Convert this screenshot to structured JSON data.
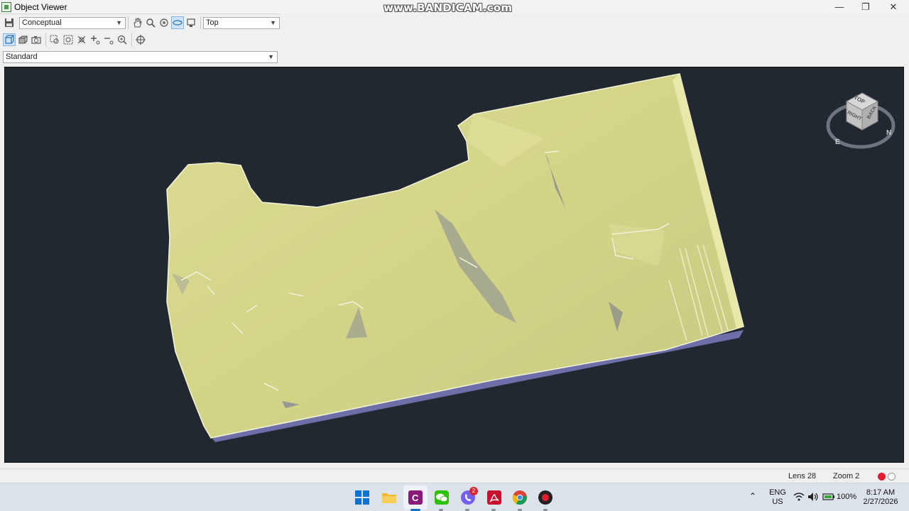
{
  "window": {
    "title": "Object Viewer",
    "watermark": "www.BANDICAM.com",
    "controls": {
      "minimize": "—",
      "restore": "❐",
      "close": "✕"
    }
  },
  "toolbar": {
    "visual_style": {
      "selected": "Conceptual"
    },
    "view": {
      "selected": "Top"
    },
    "projection": {
      "selected": "Standard"
    },
    "nav_icons": [
      "pan-icon",
      "zoom-icon",
      "orbit-icon",
      "orbit-3d-icon",
      "view-icon"
    ],
    "view_icons": [
      "parallel-icon",
      "perspective-icon",
      "camera-icon",
      "zoom-window-icon",
      "zoom-extents-icon",
      "zoom-object-icon",
      "zoom-in-icon",
      "zoom-out-icon",
      "zoom-realtime-icon",
      "center-icon"
    ]
  },
  "viewcube": {
    "faces": {
      "top": "TOP",
      "right": "RIGHT",
      "back": "BACK"
    },
    "compass": {
      "east": "E",
      "north": "N"
    }
  },
  "status": {
    "lens": "Lens 28",
    "zoom": "Zoom 2",
    "colors": {
      "record": "#e01e2e",
      "idle": "#ffffff"
    }
  },
  "taskbar": {
    "apps": [
      "windows-start-icon",
      "file-explorer-icon",
      "civil3d-icon",
      "wechat-icon",
      "viber-icon",
      "acrobat-icon",
      "chrome-icon",
      "bandicam-record-icon"
    ],
    "viber_badge": "2",
    "lang_primary": "ENG",
    "lang_secondary": "US",
    "battery": "100%",
    "time": "8:17 AM",
    "date": "2/27/2026"
  },
  "scene": {
    "surface_color": "#d9d98e",
    "shadow_color": "#8a8a9a",
    "edge_color": "#6f6fa8",
    "background": "#212830"
  }
}
